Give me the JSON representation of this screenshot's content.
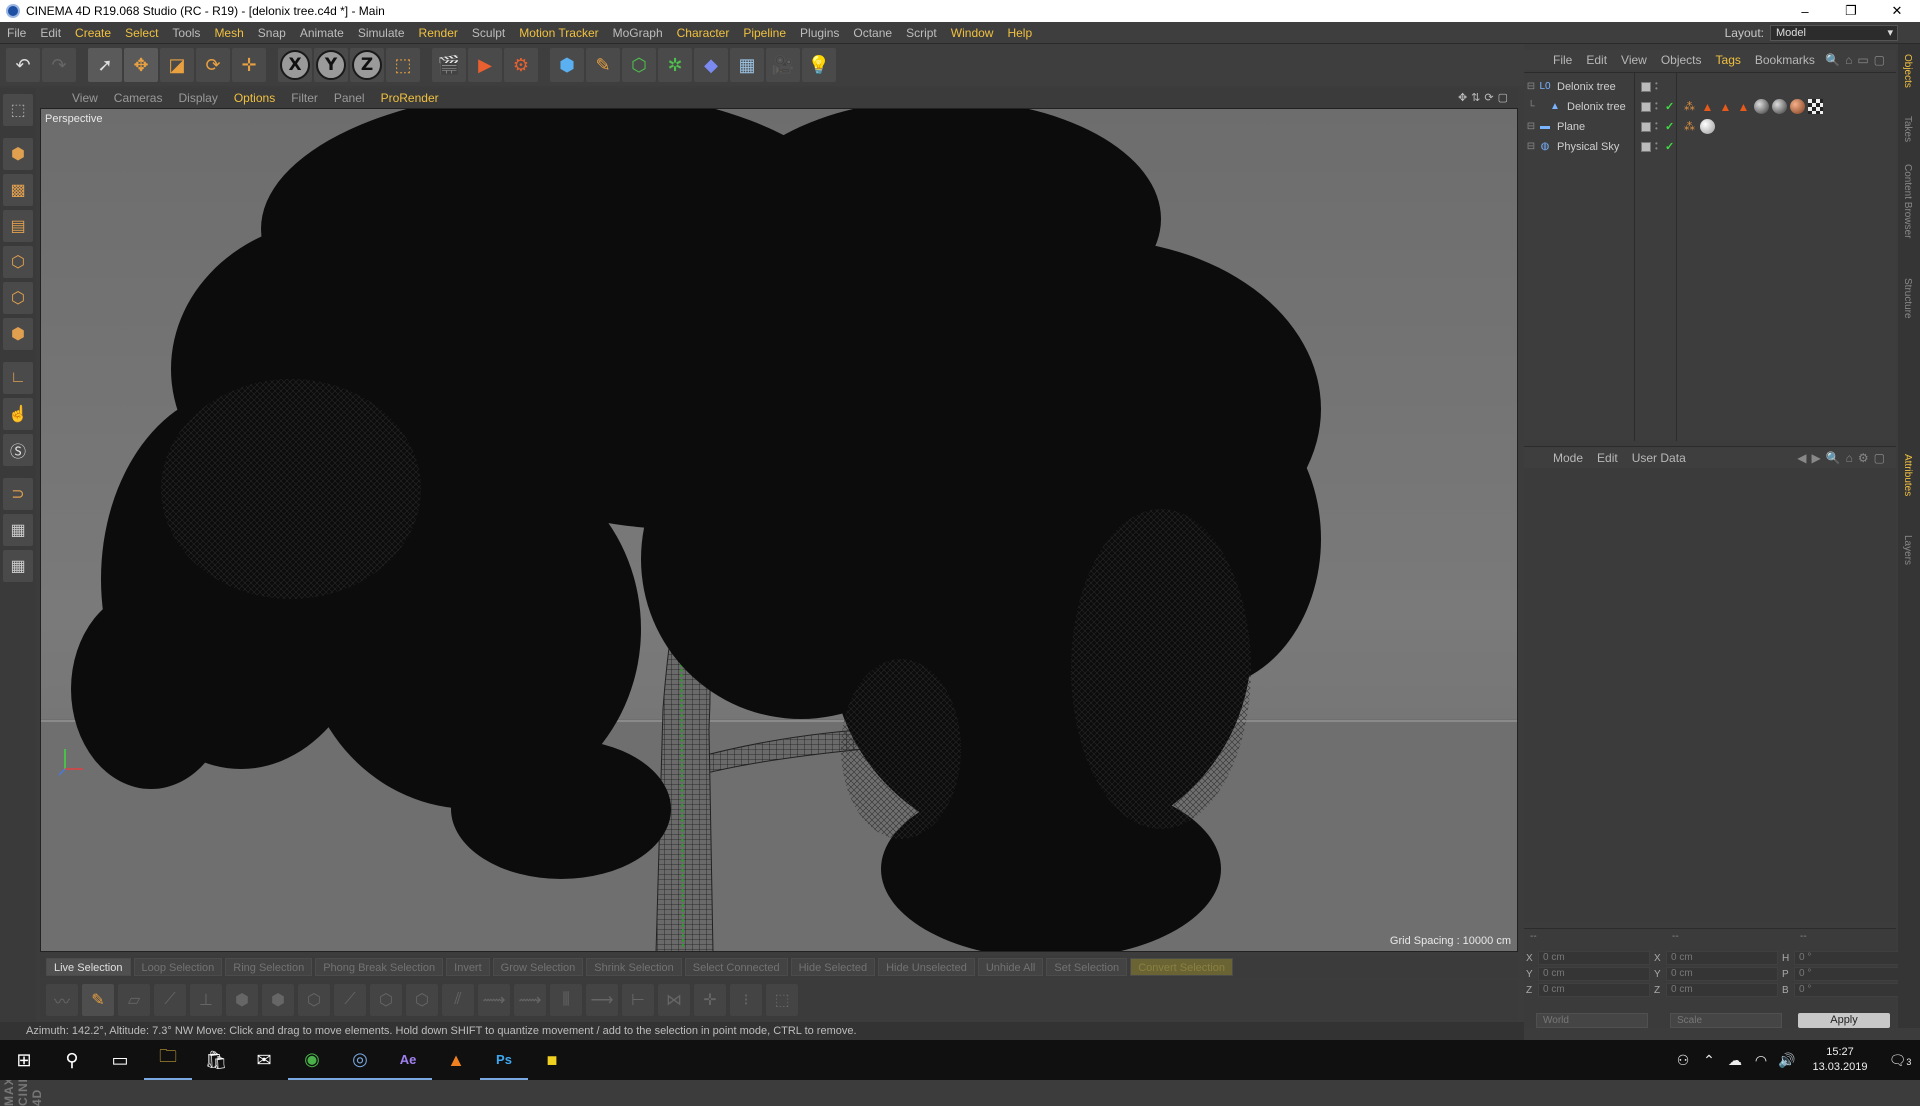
{
  "window": {
    "title": "CINEMA 4D R19.068 Studio (RC - R19) - [delonix tree.c4d *] - Main",
    "controls": [
      "–",
      "❐",
      "✕"
    ]
  },
  "menubar": {
    "items": [
      {
        "label": "File",
        "hl": false
      },
      {
        "label": "Edit",
        "hl": false
      },
      {
        "label": "Create",
        "hl": true
      },
      {
        "label": "Select",
        "hl": true
      },
      {
        "label": "Tools",
        "hl": false
      },
      {
        "label": "Mesh",
        "hl": true
      },
      {
        "label": "Snap",
        "hl": false
      },
      {
        "label": "Animate",
        "hl": false
      },
      {
        "label": "Simulate",
        "hl": false
      },
      {
        "label": "Render",
        "hl": true
      },
      {
        "label": "Sculpt",
        "hl": false
      },
      {
        "label": "Motion Tracker",
        "hl": true
      },
      {
        "label": "MoGraph",
        "hl": false
      },
      {
        "label": "Character",
        "hl": true
      },
      {
        "label": "Pipeline",
        "hl": true
      },
      {
        "label": "Plugins",
        "hl": false
      },
      {
        "label": "Octane",
        "hl": false
      },
      {
        "label": "Script",
        "hl": false
      },
      {
        "label": "Window",
        "hl": true
      },
      {
        "label": "Help",
        "hl": true
      }
    ],
    "layout_label": "Layout:",
    "layout_value": "Model"
  },
  "toolbar": {
    "axes": [
      "X",
      "Y",
      "Z"
    ]
  },
  "viewport": {
    "menu": [
      {
        "label": "View",
        "hl": false
      },
      {
        "label": "Cameras",
        "hl": false
      },
      {
        "label": "Display",
        "hl": false
      },
      {
        "label": "Options",
        "hl": true
      },
      {
        "label": "Filter",
        "hl": false
      },
      {
        "label": "Panel",
        "hl": false
      },
      {
        "label": "ProRender",
        "hl": true
      }
    ],
    "camera_label": "Perspective",
    "grid_spacing": "Grid Spacing : 10000 cm"
  },
  "command_bar": [
    {
      "label": "Live Selection",
      "state": "active"
    },
    {
      "label": "Loop Selection",
      "state": "dim"
    },
    {
      "label": "Ring Selection",
      "state": "dim"
    },
    {
      "label": "Phong Break Selection",
      "state": "dim"
    },
    {
      "label": "Invert",
      "state": "dim"
    },
    {
      "label": "Grow Selection",
      "state": "dim"
    },
    {
      "label": "Shrink Selection",
      "state": "dim"
    },
    {
      "label": "Select Connected",
      "state": "dim"
    },
    {
      "label": "Hide Selected",
      "state": "dim"
    },
    {
      "label": "Hide Unselected",
      "state": "dim"
    },
    {
      "label": "Unhide All",
      "state": "dim"
    },
    {
      "label": "Set Selection",
      "state": "dim"
    },
    {
      "label": "Convert Selection",
      "state": "accent"
    }
  ],
  "status": "Azimuth: 142.2°, Altitude: 7.3° NW    Move: Click and drag to move elements. Hold down SHIFT to quantize movement / add to the selection in point mode, CTRL to remove.",
  "object_manager": {
    "menu": [
      {
        "label": "File",
        "hl": false
      },
      {
        "label": "Edit",
        "hl": false
      },
      {
        "label": "View",
        "hl": false
      },
      {
        "label": "Objects",
        "hl": false
      },
      {
        "label": "Tags",
        "hl": true
      },
      {
        "label": "Bookmarks",
        "hl": false
      }
    ],
    "objects": [
      {
        "name": "Delonix tree",
        "indent": 0,
        "icon": "null-icon",
        "check": false
      },
      {
        "name": "Delonix tree",
        "indent": 1,
        "icon": "polygon-icon",
        "check": true
      },
      {
        "name": "Plane",
        "indent": 0,
        "icon": "plane-icon",
        "check": true
      },
      {
        "name": "Physical Sky",
        "indent": 0,
        "icon": "sky-icon",
        "check": true
      }
    ]
  },
  "attributes": {
    "menu": [
      "Mode",
      "Edit",
      "User Data"
    ]
  },
  "coordinates": {
    "headers": [
      "--",
      "--",
      "--"
    ],
    "rows": [
      {
        "a": "X",
        "av": "0 cm",
        "b": "X",
        "bv": "0 cm",
        "c": "H",
        "cv": "0 °"
      },
      {
        "a": "Y",
        "av": "0 cm",
        "b": "Y",
        "bv": "0 cm",
        "c": "P",
        "cv": "0 °"
      },
      {
        "a": "Z",
        "av": "0 cm",
        "b": "Z",
        "bv": "0 cm",
        "c": "B",
        "cv": "0 °"
      }
    ],
    "space": "World",
    "mode": "Scale",
    "apply": "Apply"
  },
  "side_tabs": [
    {
      "label": "Objects",
      "hl": true
    },
    {
      "label": "Takes",
      "hl": false
    },
    {
      "label": "Content Browser",
      "hl": false
    },
    {
      "label": "Structure",
      "hl": false
    },
    {
      "label": "Attributes",
      "hl": true
    },
    {
      "label": "Layers",
      "hl": false
    }
  ],
  "taskbar": {
    "time": "15:27",
    "date": "13.03.2019",
    "notifications": "3"
  }
}
